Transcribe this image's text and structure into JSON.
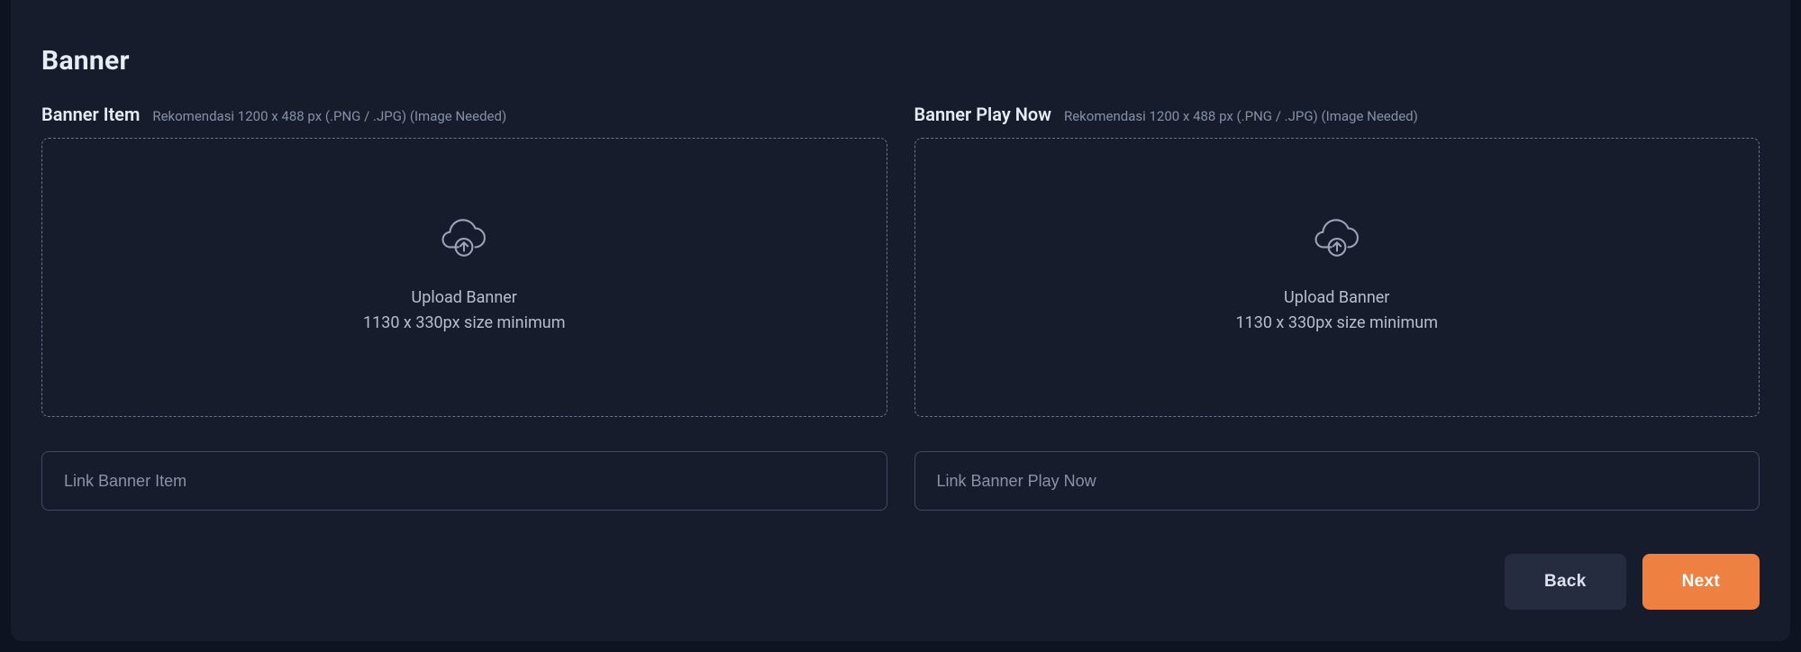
{
  "section": {
    "title": "Banner"
  },
  "left": {
    "label": "Banner Item",
    "hint": "Rekomendasi 1200 x 488 px (.PNG / .JPG) (Image Needed)",
    "upload_line1": "Upload Banner",
    "upload_line2": "1130 x 330px size minimum",
    "link_placeholder": "Link Banner Item"
  },
  "right": {
    "label": "Banner Play Now",
    "hint": "Rekomendasi 1200 x 488 px (.PNG / .JPG) (Image Needed)",
    "upload_line1": "Upload Banner",
    "upload_line2": "1130 x 330px size minimum",
    "link_placeholder": "Link Banner Play Now"
  },
  "buttons": {
    "back": "Back",
    "next": "Next"
  }
}
